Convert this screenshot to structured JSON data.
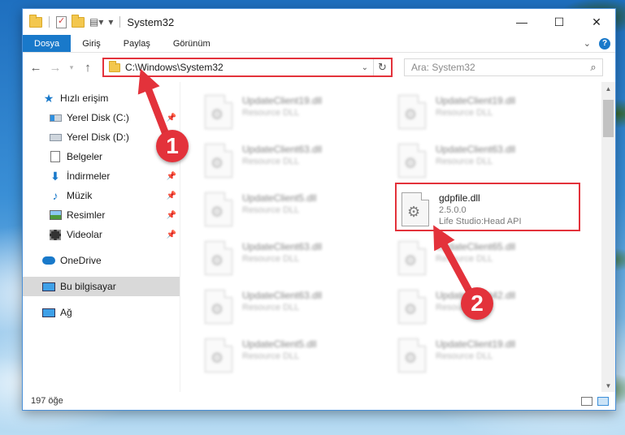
{
  "window": {
    "title": "System32",
    "minimize": "—",
    "maximize": "☐",
    "close": "✕"
  },
  "ribbon": {
    "tabs": [
      "Dosya",
      "Giriş",
      "Paylaş",
      "Görünüm"
    ],
    "help": "?"
  },
  "nav": {
    "address": "C:\\Windows\\System32",
    "search_placeholder": "Ara: System32"
  },
  "sidebar": {
    "quick_access": "Hızlı erişim",
    "items": [
      "Yerel Disk (C:)",
      "Yerel Disk (D:)",
      "Belgeler",
      "İndirmeler",
      "Müzik",
      "Resimler",
      "Videolar"
    ],
    "onedrive": "OneDrive",
    "this_pc": "Bu bilgisayar",
    "network": "Ağ"
  },
  "files": [
    {
      "name": "UpdateClient19.dll",
      "sub": "Resource DLL"
    },
    {
      "name": "UpdateClient19.dll",
      "sub": "Resource DLL"
    },
    {
      "name": "UpdateClient63.dll",
      "sub": "Resource DLL"
    },
    {
      "name": "UpdateClient63.dll",
      "sub": "Resource DLL"
    },
    {
      "name": "UpdateClient5.dll",
      "sub": "Resource DLL"
    },
    {
      "name": "gdpfile.dll",
      "sub": "2.5.0.0",
      "sub2": "Life Studio:Head API"
    },
    {
      "name": "UpdateClient63.dll",
      "sub": "Resource DLL"
    },
    {
      "name": "UpdateClient65.dll",
      "sub": "Resource DLL"
    },
    {
      "name": "UpdateClient63.dll",
      "sub": "Resource DLL"
    },
    {
      "name": "UpdateClient42.dll",
      "sub": "Resource DLL"
    },
    {
      "name": "UpdateClient5.dll",
      "sub": "Resource DLL"
    },
    {
      "name": "UpdateClient19.dll",
      "sub": "Resource DLL"
    }
  ],
  "status": {
    "count": "197 öğe"
  },
  "annotations": {
    "step1": "1",
    "step2": "2",
    "color": "#e3323b"
  }
}
